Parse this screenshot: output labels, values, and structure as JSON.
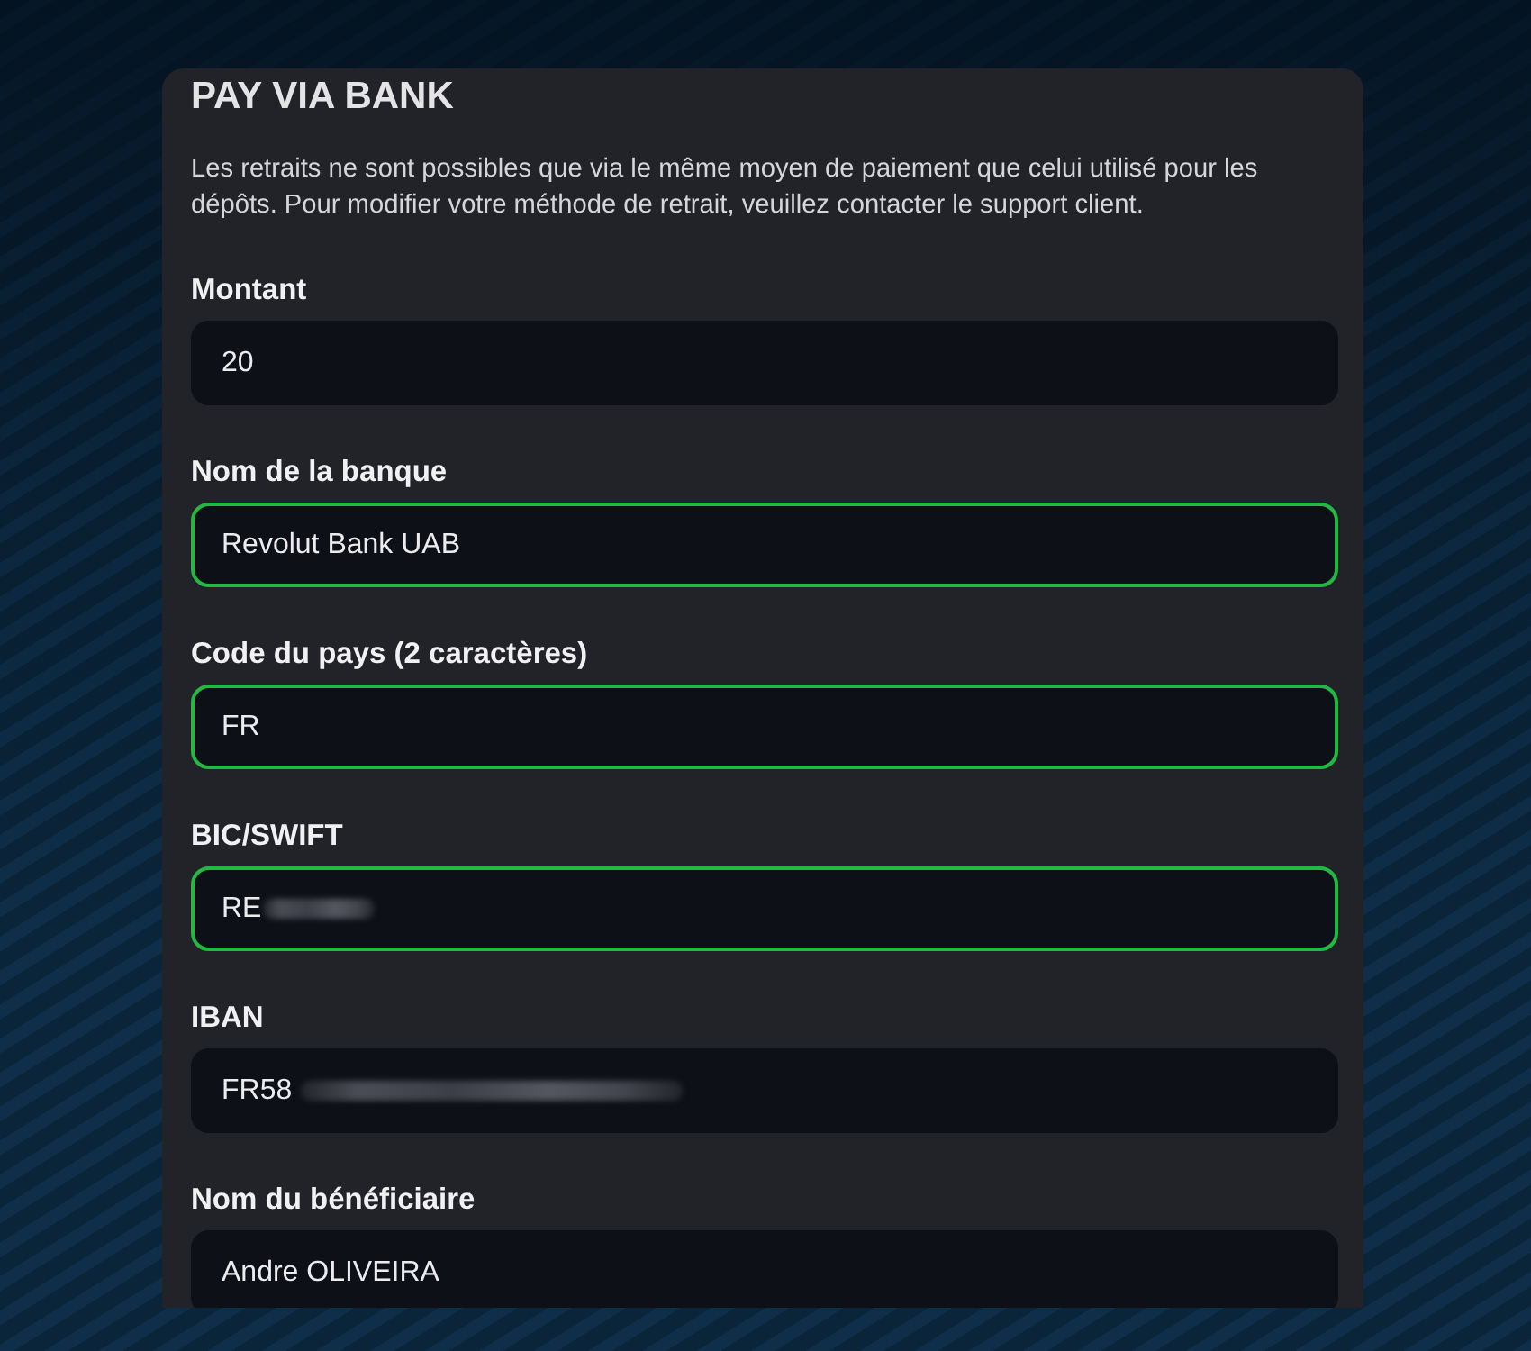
{
  "title": "PAY VIA BANK",
  "notice": "Les retraits ne sont possibles que via le même moyen de paiement que celui utilisé pour les dépôts. Pour modifier votre méthode de retrait, veuillez contacter le support client.",
  "fields": [
    {
      "label": "Montant",
      "value": "20",
      "valid": false,
      "kind": "plain"
    },
    {
      "label": "Nom de la banque",
      "value": "Revolut Bank UAB",
      "valid": true,
      "kind": "plain"
    },
    {
      "label": "Code du pays (2 caractères)",
      "value": "FR",
      "valid": true,
      "kind": "plain"
    },
    {
      "label": "BIC/SWIFT",
      "value": "RE",
      "valid": true,
      "kind": "bic"
    },
    {
      "label": "IBAN",
      "value": "FR58",
      "valid": false,
      "kind": "iban"
    },
    {
      "label": "Nom du bénéficiaire",
      "value": "Andre OLIVEIRA",
      "valid": false,
      "kind": "plain"
    }
  ]
}
